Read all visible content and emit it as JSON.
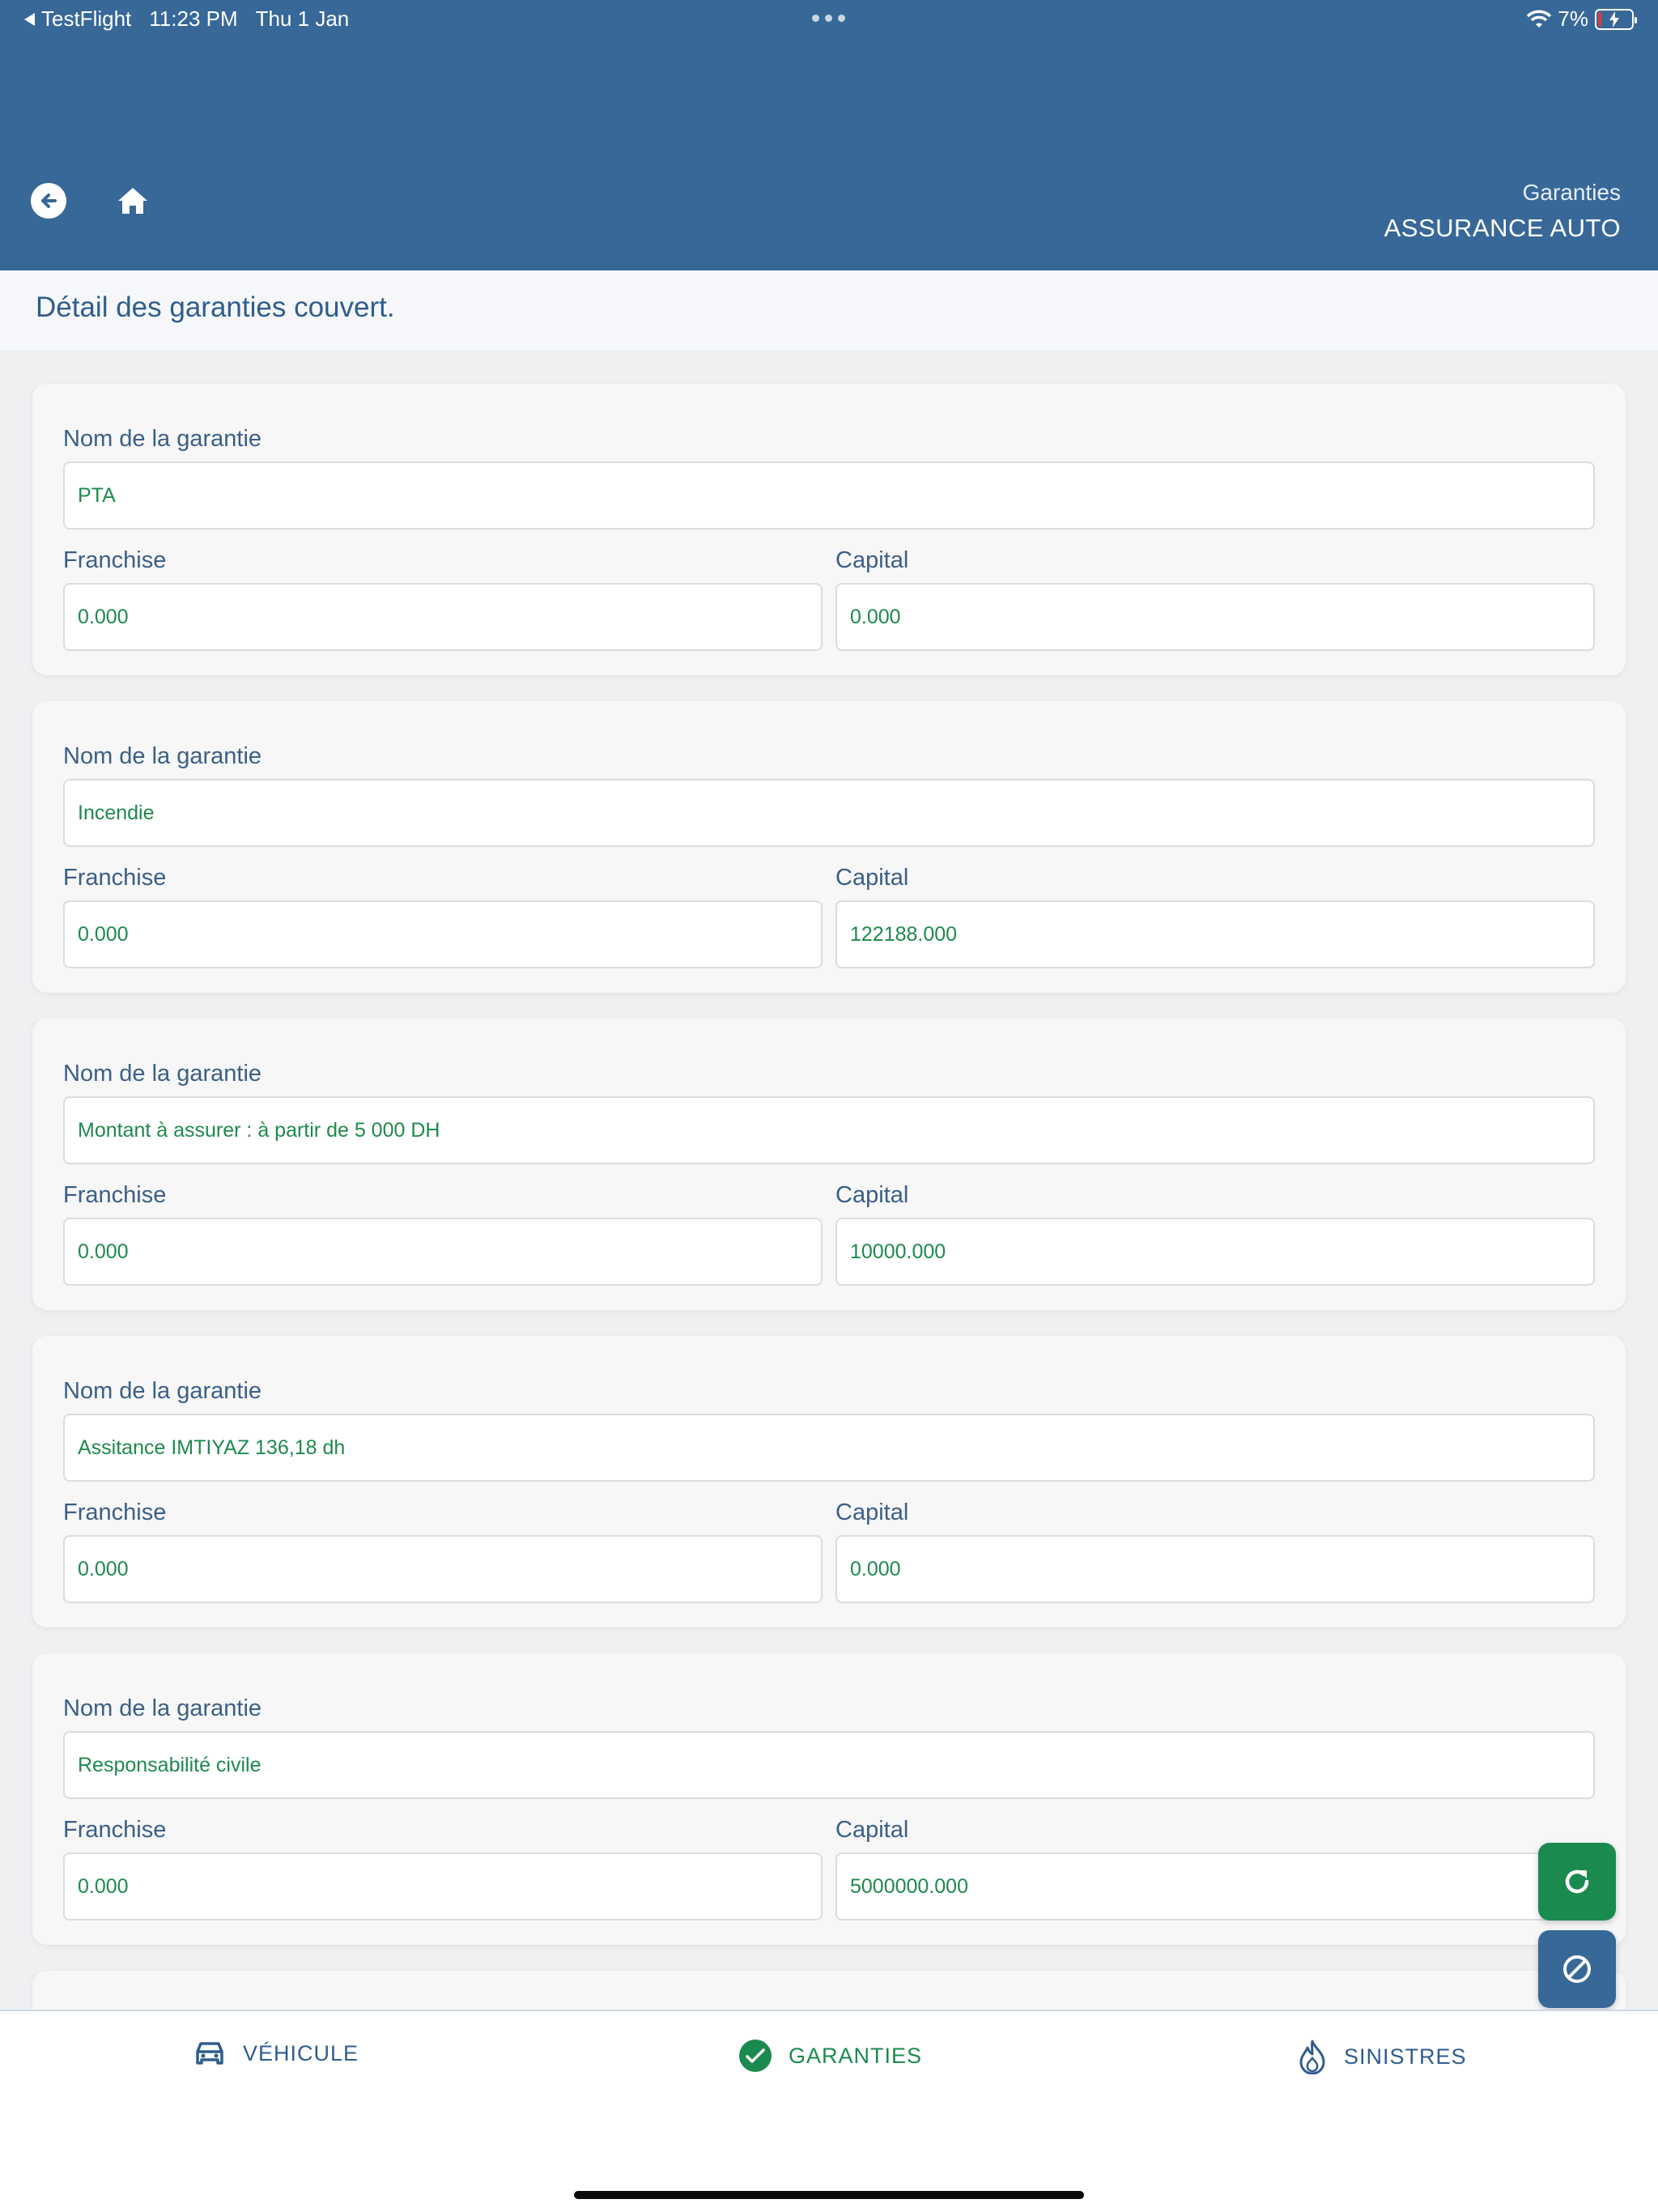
{
  "status_bar": {
    "back_app": "TestFlight",
    "time": "11:23 PM",
    "date": "Thu 1 Jan",
    "battery": "7%"
  },
  "header": {
    "subtitle": "Garanties",
    "title": "ASSURANCE AUTO"
  },
  "section": {
    "title": "Détail des garanties couvert."
  },
  "labels": {
    "name": "Nom de la garantie",
    "franchise": "Franchise",
    "capital": "Capital"
  },
  "guarantees": [
    {
      "name": "PTA",
      "franchise": "0.000",
      "capital": "0.000"
    },
    {
      "name": "Incendie",
      "franchise": "0.000",
      "capital": "122188.000"
    },
    {
      "name": "Montant à assurer : à partir de 5 000 DH",
      "franchise": "0.000",
      "capital": "10000.000"
    },
    {
      "name": "Assitance IMTIYAZ 136,18 dh",
      "franchise": "0.000",
      "capital": "0.000"
    },
    {
      "name": "Responsabilité civile",
      "franchise": "0.000",
      "capital": "5000000.000"
    }
  ],
  "tabs": [
    {
      "label": "VÉHICULE",
      "icon": "car-icon",
      "active": false
    },
    {
      "label": "GARANTIES",
      "icon": "check-circle-icon",
      "active": true
    },
    {
      "label": "SINISTRES",
      "icon": "flame-icon",
      "active": false
    }
  ],
  "colors": {
    "header_bg": "#376898",
    "value_text": "#1e8a4c",
    "label_text": "#3b5f86",
    "refresh_button": "#1b8a4e",
    "cancel_button": "#376898"
  }
}
